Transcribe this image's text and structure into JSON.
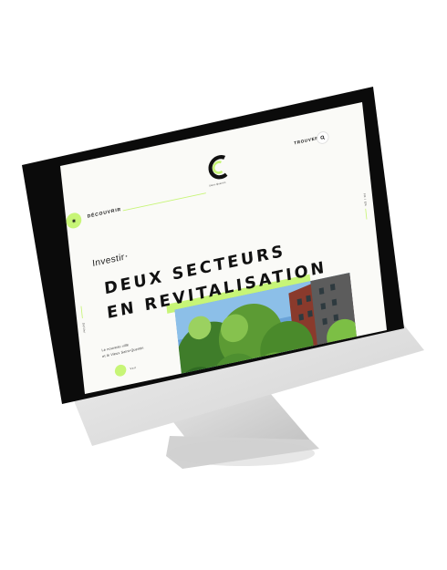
{
  "nav": {
    "discover_label": "DÉCOUVRIR",
    "find_label": "TROUVER"
  },
  "logo": {
    "subtitle": "Saint-Quentin"
  },
  "hero": {
    "kicker": "Investir",
    "title_line1": "DEUX SECTEURS",
    "title_line2": "EN REVITALISATION",
    "caption_line1": "Le nouveau ville",
    "caption_line2": "et le Vieux Saint-Quentin",
    "cta_label": "Voir"
  },
  "side": {
    "left_label": "Défiler",
    "right_label": "FR / EN"
  },
  "colors": {
    "accent": "#c7f577",
    "bezel": "#0b0b0b",
    "aluminum": "#d9d9d9"
  }
}
